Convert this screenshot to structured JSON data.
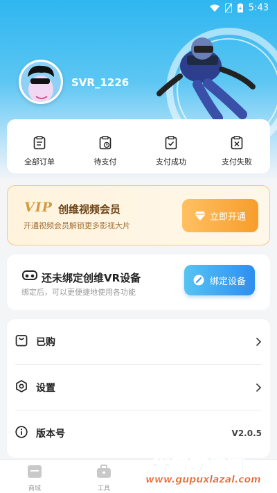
{
  "status": {
    "time": "5:43"
  },
  "profile": {
    "username": "SVR_1226"
  },
  "orders": [
    {
      "label": "全部订单",
      "icon": "clipboard-list-icon"
    },
    {
      "label": "待支付",
      "icon": "clipboard-clock-icon"
    },
    {
      "label": "支付成功",
      "icon": "clipboard-check-icon"
    },
    {
      "label": "支付失败",
      "icon": "clipboard-x-icon"
    }
  ],
  "vip": {
    "logo": "VIP",
    "title": "创维视频会员",
    "subtitle": "开通视频会员解锁更多影视大片",
    "button": "立即开通",
    "accent": "#f79d2b"
  },
  "bind_device": {
    "title": "还未绑定创维VR设备",
    "subtitle": "绑定后，可以更便捷地使用各功能",
    "button": "绑定设备",
    "accent": "#2e8ef0"
  },
  "menu": [
    {
      "label": "已购",
      "icon": "bag-icon",
      "right": ""
    },
    {
      "label": "设置",
      "icon": "settings-icon",
      "right": ""
    },
    {
      "label": "版本号",
      "icon": "info-icon",
      "right": "V2.0.5"
    }
  ],
  "tabs": [
    {
      "label": "商城",
      "icon": "store-icon"
    },
    {
      "label": "工具",
      "icon": "toolbox-icon"
    }
  ],
  "watermark": {
    "title": "谷普软件园",
    "url": "www.gupuxlazal.com"
  }
}
